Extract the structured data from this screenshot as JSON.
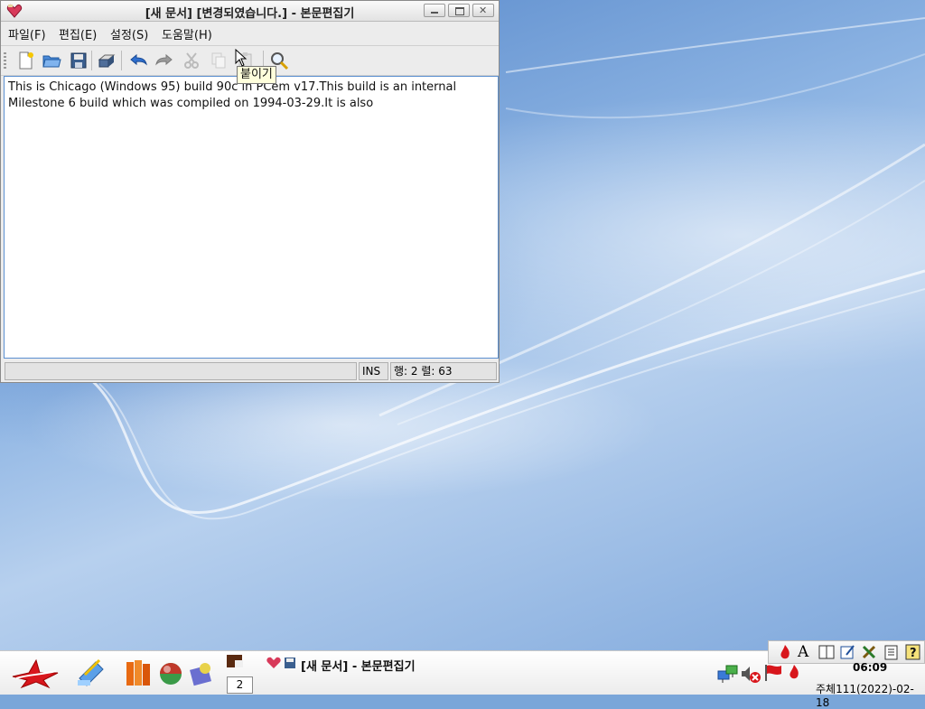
{
  "window": {
    "title": "[새 문서] [변경되였습니다.] - 본문편집기"
  },
  "menu": {
    "file": "파일(F)",
    "edit": "편집(E)",
    "settings": "설정(S)",
    "help": "도움말(H)"
  },
  "toolbar": {
    "items": [
      "new-document-icon",
      "open-folder-icon",
      "save-icon",
      "print-icon",
      "undo-icon",
      "redo-icon",
      "cut-icon",
      "copy-icon",
      "paste-icon",
      "find-icon"
    ],
    "tooltip": "붙이기"
  },
  "editor": {
    "text": "This is Chicago (Windows 95) build 90c in PCem v17.This build is an internal\nMilestone 6 build which was compiled on 1994-03-29.It is also"
  },
  "status": {
    "message": "",
    "mode": "INS",
    "position": "행: 2 렬: 63"
  },
  "taskbar": {
    "pager_current": "2",
    "task_title": "[새 문서] - 본문편집기",
    "clock": "06:09",
    "date": "주체111(2022)-02-18"
  },
  "colors": {
    "desktop": "#7aa6d9",
    "editor_border": "#5b8fd0",
    "tooltip_bg": "#ffffdc",
    "accent_red": "#d8161c"
  }
}
